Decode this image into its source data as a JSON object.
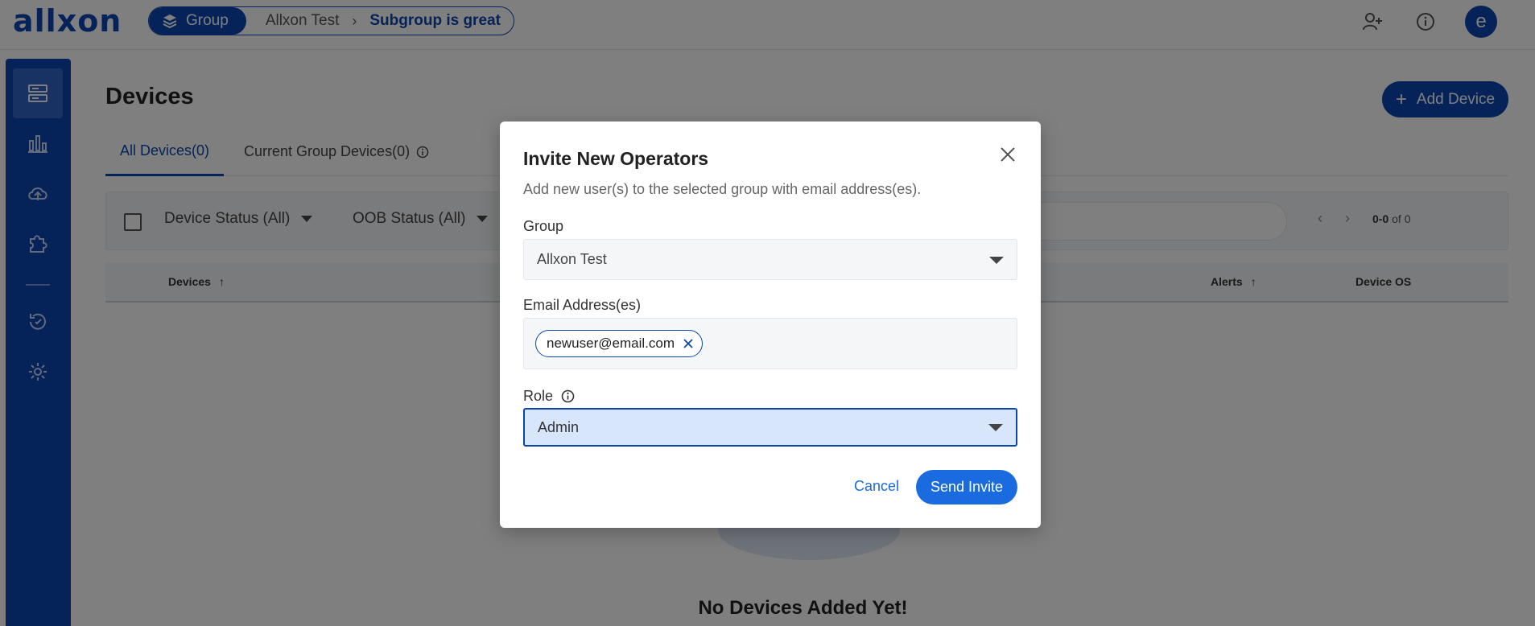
{
  "app": {
    "logo": "allxon"
  },
  "breadcrumb": {
    "group_label": "Group",
    "item": "Allxon Test",
    "current": "Subgroup is great"
  },
  "topbar": {
    "avatar_initial": "e"
  },
  "page": {
    "title": "Devices",
    "add_button": "Add Device",
    "tabs": [
      {
        "label": "All Devices(0)"
      },
      {
        "label": "Current Group Devices(0)"
      }
    ],
    "filters": {
      "device_status": "Device Status (All)",
      "oob_status": "OOB Status (All)"
    },
    "pager": {
      "range": "0-0",
      "of": "of 0"
    },
    "columns": {
      "devices": "Devices",
      "alerts": "Alerts",
      "device_os": "Device OS"
    },
    "empty_text": "No Devices Added Yet!"
  },
  "modal": {
    "title": "Invite New Operators",
    "description": "Add new user(s) to the selected group with email address(es).",
    "group_label": "Group",
    "group_value": "Allxon Test",
    "email_label": "Email Address(es)",
    "emails": [
      "newuser@email.com"
    ],
    "role_label": "Role",
    "role_value": "Admin",
    "cancel": "Cancel",
    "send": "Send Invite"
  }
}
